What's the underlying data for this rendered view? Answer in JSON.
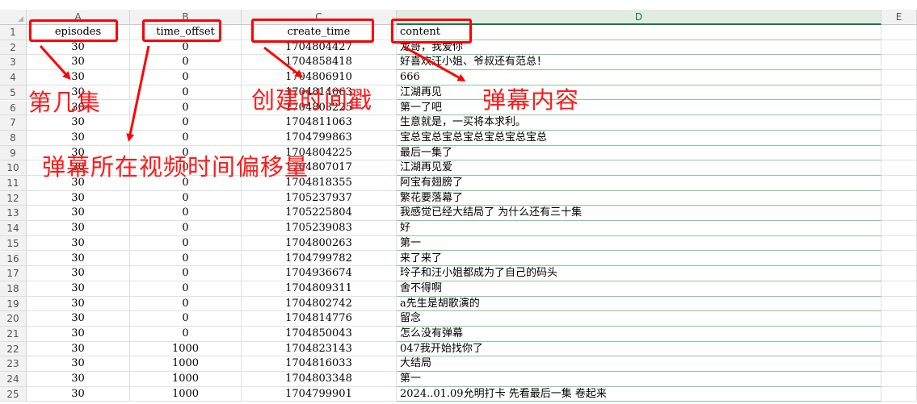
{
  "columns": [
    "A",
    "B",
    "C",
    "D",
    "E"
  ],
  "row_numbers": [
    "1",
    "2",
    "3",
    "4",
    "5",
    "6",
    "7",
    "8",
    "9",
    "10",
    "11",
    "12",
    "13",
    "14",
    "15",
    "16",
    "17",
    "18",
    "19",
    "20",
    "21",
    "22",
    "23",
    "24",
    "25"
  ],
  "header_row": {
    "episodes": "episodes",
    "time_offset": "time_offset",
    "create_time": "create_time",
    "content": "content"
  },
  "rows": [
    {
      "episodes": "30",
      "time_offset": "0",
      "create_time": "1704804427",
      "content": "龙哥，我爱你"
    },
    {
      "episodes": "30",
      "time_offset": "0",
      "create_time": "1704858418",
      "content": "好喜欢汪小姐、爷叔还有范总！"
    },
    {
      "episodes": "30",
      "time_offset": "0",
      "create_time": "1704806910",
      "content": "666"
    },
    {
      "episodes": "30",
      "time_offset": "0",
      "create_time": "1704814063",
      "content": "江湖再见"
    },
    {
      "episodes": "30",
      "time_offset": "0",
      "create_time": "1704803225",
      "content": "第一了吧"
    },
    {
      "episodes": "30",
      "time_offset": "0",
      "create_time": "1704811063",
      "content": "生意就是，一买将本求利。"
    },
    {
      "episodes": "30",
      "time_offset": "0",
      "create_time": "1704799863",
      "content": "宝总宝总宝总宝总宝总宝总宝总"
    },
    {
      "episodes": "30",
      "time_offset": "0",
      "create_time": "1704804225",
      "content": "最后一集了"
    },
    {
      "episodes": "30",
      "time_offset": "0",
      "create_time": "1704807017",
      "content": "江湖再见爱"
    },
    {
      "episodes": "30",
      "time_offset": "0",
      "create_time": "1704818355",
      "content": "阿宝有翅膀了"
    },
    {
      "episodes": "30",
      "time_offset": "0",
      "create_time": "1705237937",
      "content": "繁花要落幕了"
    },
    {
      "episodes": "30",
      "time_offset": "0",
      "create_time": "1705225804",
      "content": "我感觉已经大结局了 为什么还有三十集"
    },
    {
      "episodes": "30",
      "time_offset": "0",
      "create_time": "1705239083",
      "content": "好"
    },
    {
      "episodes": "30",
      "time_offset": "0",
      "create_time": "1704800263",
      "content": "第一"
    },
    {
      "episodes": "30",
      "time_offset": "0",
      "create_time": "1704799782",
      "content": "来了来了"
    },
    {
      "episodes": "30",
      "time_offset": "0",
      "create_time": "1704936674",
      "content": "玲子和汪小姐都成为了自己的码头"
    },
    {
      "episodes": "30",
      "time_offset": "0",
      "create_time": "1704809311",
      "content": "舍不得啊"
    },
    {
      "episodes": "30",
      "time_offset": "0",
      "create_time": "1704802742",
      "content": "a先生是胡歌演的"
    },
    {
      "episodes": "30",
      "time_offset": "0",
      "create_time": "1704814776",
      "content": "留念"
    },
    {
      "episodes": "30",
      "time_offset": "0",
      "create_time": "1704850043",
      "content": "怎么没有弹幕"
    },
    {
      "episodes": "30",
      "time_offset": "1000",
      "create_time": "1704823143",
      "content": "047我开始找你了"
    },
    {
      "episodes": "30",
      "time_offset": "1000",
      "create_time": "1704816033",
      "content": "大结局"
    },
    {
      "episodes": "30",
      "time_offset": "1000",
      "create_time": "1704803348",
      "content": "第一"
    },
    {
      "episodes": "30",
      "time_offset": "1000",
      "create_time": "1704799901",
      "content": "2024..01.09允明打卡 先看最后一集 卷起来"
    }
  ],
  "annotations": {
    "episodes": "第几集",
    "time_offset": "弹幕所在视频时间偏移量",
    "create_time": "创建时间戳",
    "content": "弹幕内容"
  },
  "colors": {
    "annotation": "#ff0000",
    "active_column": "#217346",
    "header_bg": "#f2f2f2"
  }
}
